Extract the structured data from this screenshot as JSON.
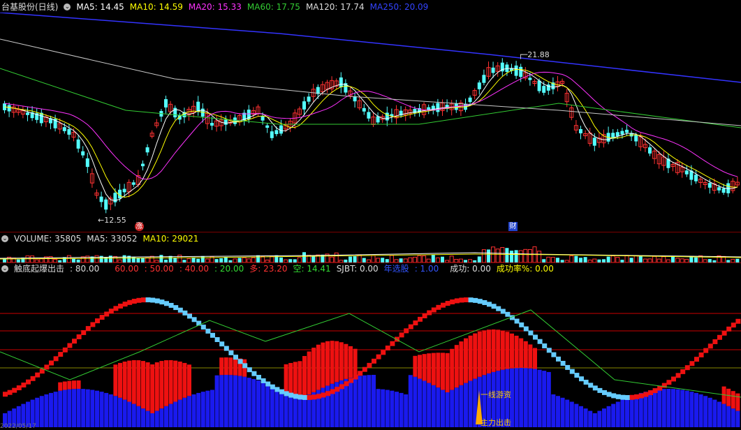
{
  "price_panel": {
    "stock_name": "台基股份(日线)",
    "ma5": "MA5: 14.45",
    "ma10": "MA10: 14.59",
    "ma20": "MA20: 15.33",
    "ma60": "MA60: 17.75",
    "ma120": "MA120: 17.74",
    "ma250": "MA250: 20.09",
    "high_label": "21.88",
    "low_label": "12.55",
    "badge_zhang": "涨",
    "badge_cai": "财",
    "colors": {
      "ma5": "#ffffff",
      "ma10": "#ffff00",
      "ma20": "#ff33ff",
      "ma60": "#33cc33",
      "ma120": "#c8c8c8",
      "ma250": "#3333ff",
      "up": "#ff3232",
      "down": "#54ffff"
    }
  },
  "volume_panel": {
    "volume": "VOLUME: 35805",
    "ma5": "MA5: 33052",
    "ma10": "MA10: 29021"
  },
  "indicator_panel": {
    "name": "触底起爆出击",
    "v80": ": 80.00",
    "v60": "60.00",
    "v50": ": 50.00",
    "v40": ": 40.00",
    "v20": ": 20.00",
    "duo": "多: 23.20",
    "kong": "空: 14.41",
    "sjbt": "SJBT: 0.00",
    "nianxian": "年选股",
    "nianxian_val": ": 1.00",
    "chenggong": "成功: 0.00",
    "chenggonglv": "成功率%: 0.00",
    "annot_yixian": "一线游资",
    "annot_zhuli": "主力出击",
    "date_stub": "2022/05/17"
  },
  "chart_data": {
    "type": "candlestick",
    "title": "台基股份(日线)",
    "price_high": 21.88,
    "price_low": 12.55,
    "moving_averages": {
      "MA5": 14.45,
      "MA10": 14.59,
      "MA20": 15.33,
      "MA60": 17.75,
      "MA120": 17.74,
      "MA250": 20.09
    },
    "volume": {
      "VOLUME": 35805,
      "MA5": 33052,
      "MA10": 29021
    },
    "indicator": {
      "80": 80.0,
      "60": 60.0,
      "50": 50.0,
      "40": 40.0,
      "20": 20.0,
      "多": 23.2,
      "空": 14.41,
      "SJBT": 0.0,
      "年选股": 1.0,
      "成功": 0.0,
      "成功率%": 0.0
    }
  }
}
